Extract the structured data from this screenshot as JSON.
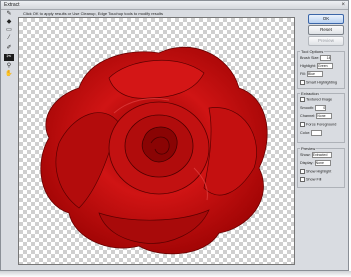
{
  "window": {
    "title": "Extract"
  },
  "hint": "Click OK to apply results or Use Cleanup, Edge Touchup tools to modify results",
  "tools": [
    "edge-highlighter",
    "fill",
    "eraser",
    "eyedropper",
    "cleanup",
    "edge-touchup",
    "zoom",
    "hand"
  ],
  "buttons": {
    "ok": "OK",
    "reset": "Reset",
    "preview": "Preview"
  },
  "tool_options": {
    "title": "Tool Options",
    "brush_size_label": "Brush Size:",
    "brush_size_value": "14",
    "highlight_label": "Highlight:",
    "highlight_value": "Green",
    "fill_label": "Fill:",
    "fill_value": "Blue",
    "smart_highlighting": "Smart Highlighting"
  },
  "extraction": {
    "title": "Extraction",
    "textured_image": "Textured Image",
    "smooth_label": "Smooth:",
    "smooth_value": "0",
    "channel_label": "Channel:",
    "channel_value": "None",
    "force_foreground": "Force Foreground",
    "color_label": "Color:"
  },
  "preview_group": {
    "title": "Preview",
    "show_label": "Show:",
    "show_value": "Extracted",
    "display_label": "Display:",
    "display_value": "None",
    "show_highlight": "Show Highlight",
    "show_fill": "Show Fill"
  },
  "colors": {
    "rose": "#c80d0d",
    "rose_dark": "#6a0000",
    "accent": "#3b66a8"
  }
}
